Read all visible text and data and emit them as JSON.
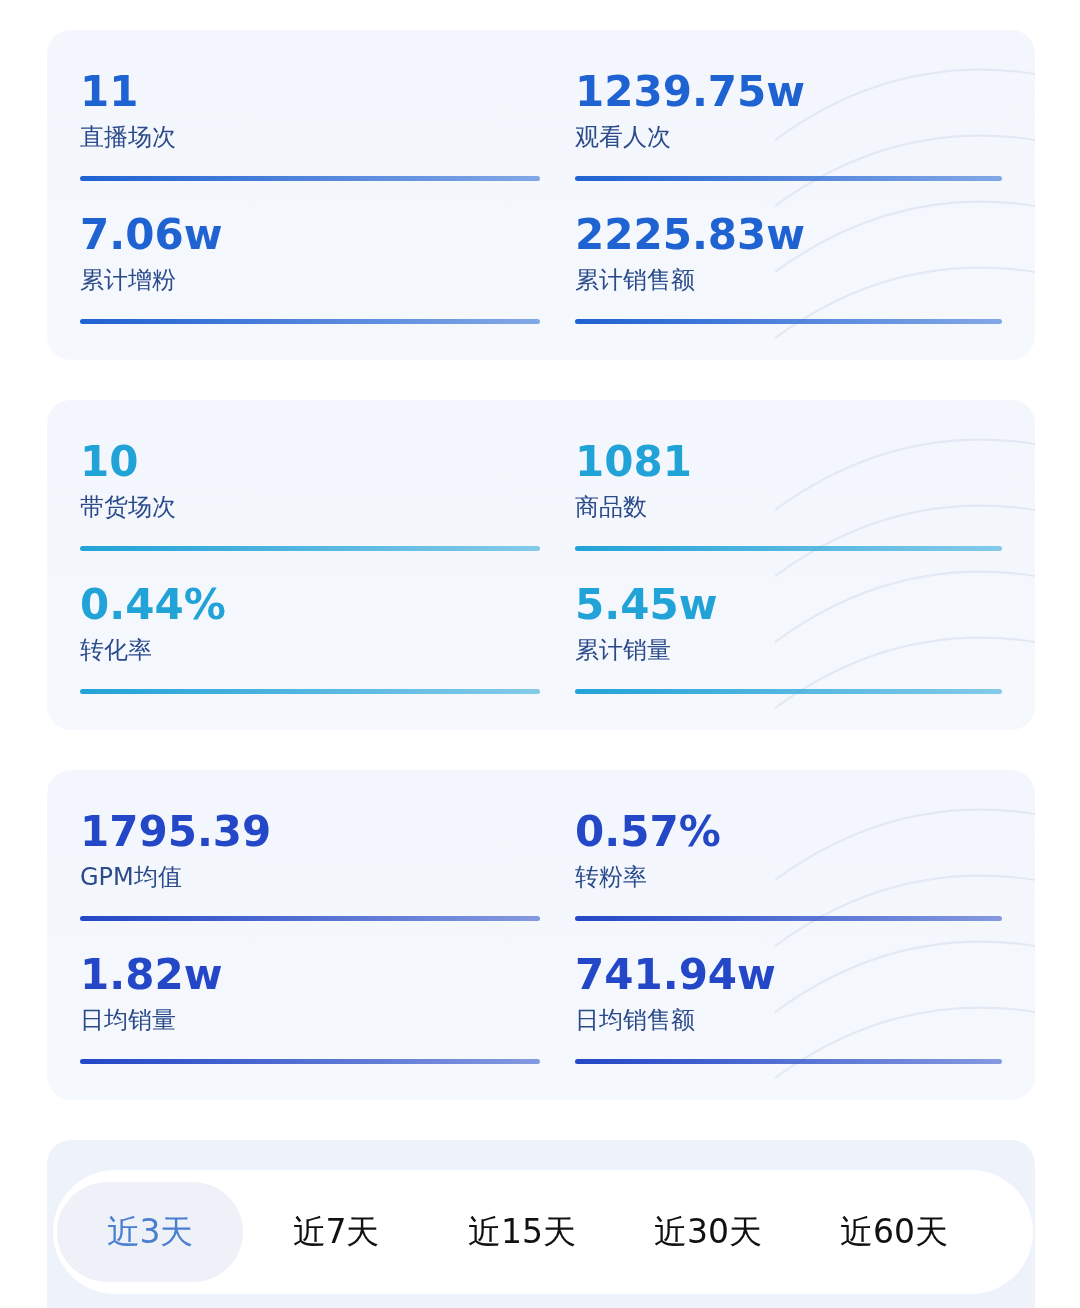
{
  "cards": [
    {
      "color": "#1f62d2",
      "stats": [
        {
          "value": "11",
          "label": "直播场次"
        },
        {
          "value": "1239.75w",
          "label": "观看人次"
        },
        {
          "value": "7.06w",
          "label": "累计增粉"
        },
        {
          "value": "2225.83w",
          "label": "累计销售额"
        }
      ]
    },
    {
      "color": "#22a3d8",
      "stats": [
        {
          "value": "10",
          "label": "带货场次"
        },
        {
          "value": "1081",
          "label": "商品数"
        },
        {
          "value": "0.44%",
          "label": "转化率"
        },
        {
          "value": "5.45w",
          "label": "累计销量"
        }
      ]
    },
    {
      "color": "#2347c6",
      "stats": [
        {
          "value": "1795.39",
          "label": "GPM均值"
        },
        {
          "value": "0.57%",
          "label": "转粉率"
        },
        {
          "value": "1.82w",
          "label": "日均销量"
        },
        {
          "value": "741.94w",
          "label": "日均销售额"
        }
      ]
    }
  ],
  "period_tabs": [
    {
      "label": "近3天",
      "selected": true
    },
    {
      "label": "近7天",
      "selected": false
    },
    {
      "label": "近15天",
      "selected": false
    },
    {
      "label": "近30天",
      "selected": false
    },
    {
      "label": "近60天",
      "selected": false
    }
  ]
}
